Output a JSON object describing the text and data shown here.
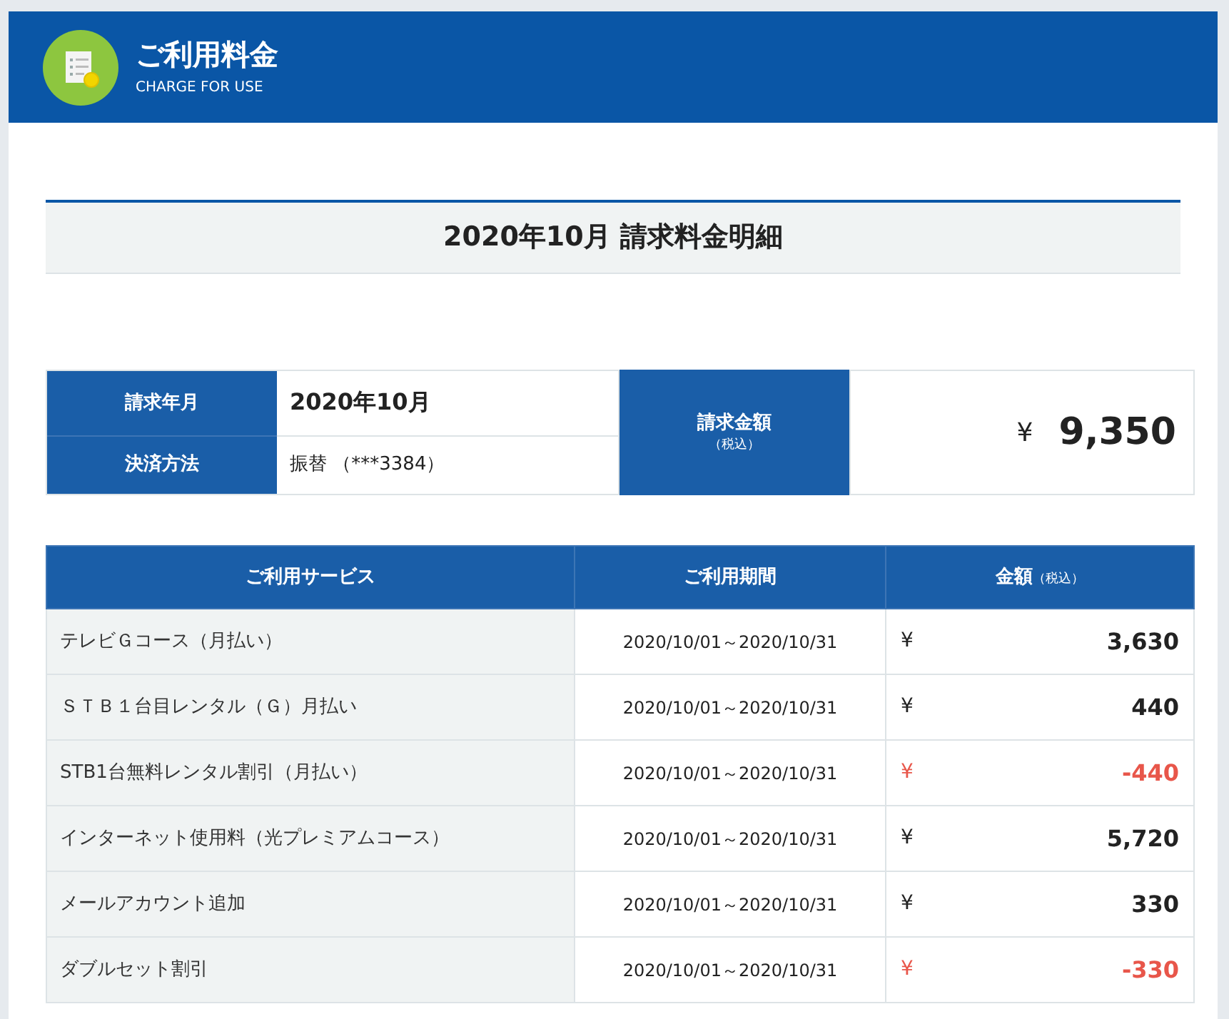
{
  "header": {
    "title": "ご利用料金",
    "subtitle": "CHARGE FOR USE"
  },
  "statement_title": "2020年10月 請求料金明細",
  "summary": {
    "billing_month_label": "請求年月",
    "billing_month": "2020年10月",
    "payment_method_label": "決済方法",
    "payment_method": "振替",
    "account": "（***3384）",
    "amount_label": "請求金額",
    "amount_note": "（税込）",
    "currency": "¥",
    "amount": "9,350"
  },
  "table": {
    "columns": [
      {
        "label": "ご利用サービス"
      },
      {
        "label": "ご利用期間"
      },
      {
        "label": "金額",
        "note": "（税込）"
      }
    ],
    "rows": [
      {
        "service": "テレビＧコース（月払い）",
        "period": "2020/10/01～2020/10/31",
        "currency": "¥",
        "amount": "3,630",
        "negative": false
      },
      {
        "service": "ＳＴＢ１台目レンタル（Ｇ）月払い",
        "period": "2020/10/01～2020/10/31",
        "currency": "¥",
        "amount": "440",
        "negative": false
      },
      {
        "service": "STB1台無料レンタル割引（月払い）",
        "period": "2020/10/01～2020/10/31",
        "currency": "¥",
        "amount": "-440",
        "negative": true
      },
      {
        "service": "インターネット使用料（光プレミアムコース）",
        "period": "2020/10/01～2020/10/31",
        "currency": "¥",
        "amount": "5,720",
        "negative": false
      },
      {
        "service": "メールアカウント追加",
        "period": "2020/10/01～2020/10/31",
        "currency": "¥",
        "amount": "330",
        "negative": false
      },
      {
        "service": "ダブルセット割引",
        "period": "2020/10/01～2020/10/31",
        "currency": "¥",
        "amount": "-330",
        "negative": true
      }
    ]
  }
}
